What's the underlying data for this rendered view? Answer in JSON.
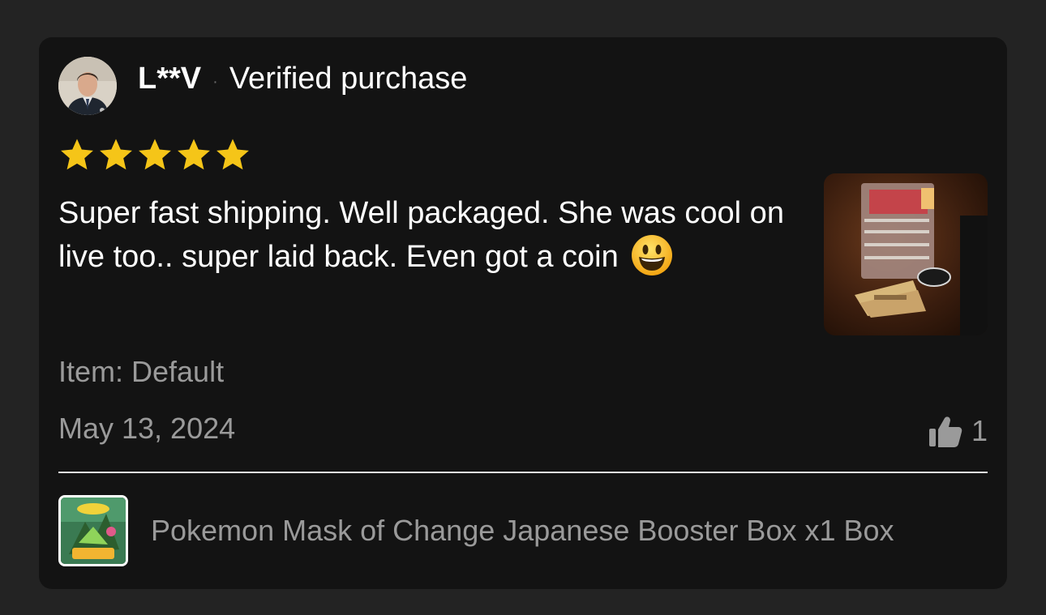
{
  "review": {
    "username": "L**V",
    "separator": "·",
    "verified_label": "Verified purchase",
    "rating": 5,
    "max_rating": 5,
    "star_color": "#f5c518",
    "text": "Super fast shipping. Well packaged. She was cool on live too.. super laid back. Even got a coin",
    "emoji_icon": "smiley-face-icon",
    "item_label": "Item: Default",
    "date": "May 13, 2024",
    "helpful_count": "1",
    "helpful_icon": "thumbs-up-icon"
  },
  "product": {
    "title": "Pokemon Mask of Change Japanese Booster Box x1 Box"
  }
}
